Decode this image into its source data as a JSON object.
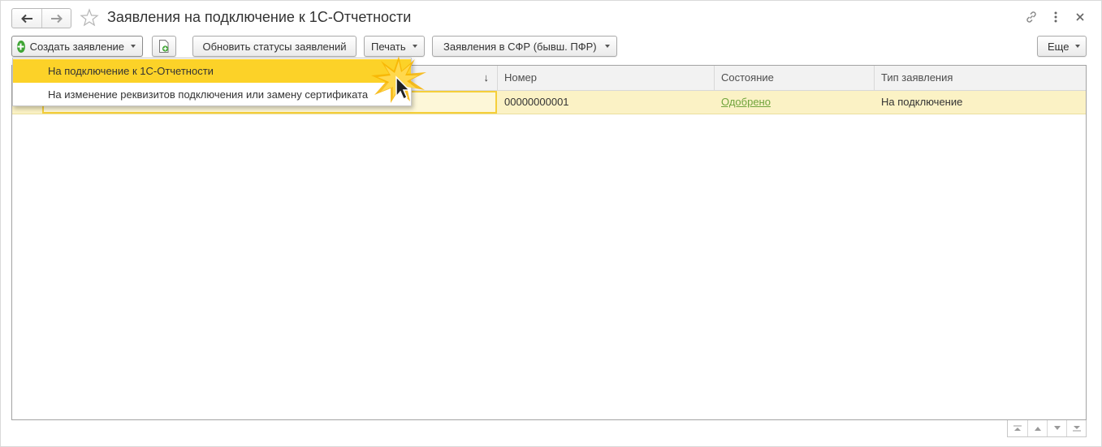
{
  "window": {
    "title": "Заявления на подключение к 1С-Отчетности",
    "icons": [
      "back-arrow-icon",
      "forward-arrow-icon",
      "star-icon",
      "link-icon",
      "more-vertical-icon",
      "close-icon"
    ]
  },
  "toolbar": {
    "create_label": "Создать заявление",
    "refresh_label": "Обновить статусы заявлений",
    "print_label": "Печать",
    "sfr_label": "Заявления в СФР (бывш. ПФР)",
    "more_label": "Еще"
  },
  "menu": {
    "items": [
      {
        "label": "На подключение к 1С-Отчетности",
        "highlighted": true
      },
      {
        "label": "На изменение реквизитов подключения или замену сертификата",
        "highlighted": false
      }
    ]
  },
  "table": {
    "columns": [
      {
        "label": ""
      },
      {
        "label": "Номер"
      },
      {
        "label": "Состояние"
      },
      {
        "label": "Тип заявления"
      }
    ],
    "sort_indicator": "↓",
    "rows": [
      {
        "date": "",
        "number": "00000000001",
        "status": "Одобрено",
        "type": "На подключение"
      }
    ]
  },
  "colors": {
    "menu_highlight": "#fcd228",
    "row_selected": "#fbf2c5",
    "status_link": "#70a43c",
    "create_icon": "#3fa535"
  }
}
